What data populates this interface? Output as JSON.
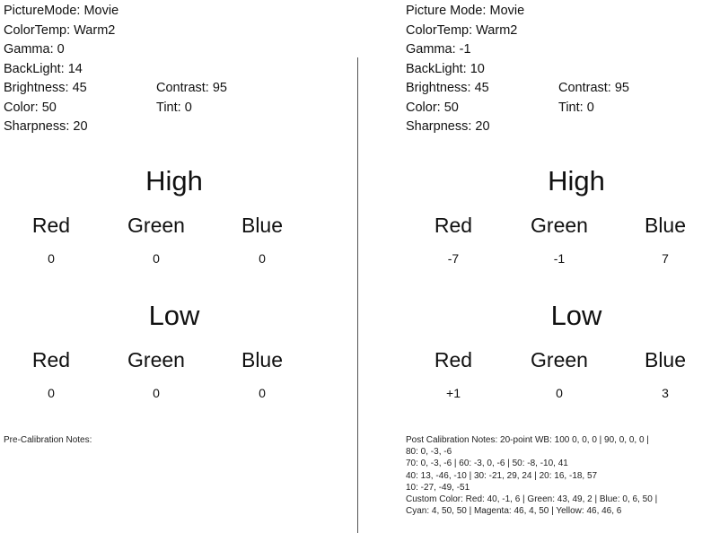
{
  "pre": {
    "settings": {
      "picture_mode": "PictureMode: Movie",
      "color_temp": "ColorTemp: Warm2",
      "gamma": "Gamma: 0",
      "backlight": "BackLight: 14",
      "brightness": "Brightness: 45",
      "contrast": "Contrast: 95",
      "color": "Color: 50",
      "tint": "Tint: 0",
      "sharpness": "Sharpness: 20"
    },
    "high": {
      "title": "High",
      "labels": [
        "Red",
        "Green",
        "Blue"
      ],
      "values": [
        "0",
        "0",
        "0"
      ]
    },
    "low": {
      "title": "Low",
      "labels": [
        "Red",
        "Green",
        "Blue"
      ],
      "values": [
        "0",
        "0",
        "0"
      ]
    },
    "notes": [
      "Pre-Calibration Notes:"
    ]
  },
  "post": {
    "settings": {
      "picture_mode": "Picture Mode: Movie",
      "color_temp": "ColorTemp: Warm2",
      "gamma": "Gamma: -1",
      "backlight": "BackLight: 10",
      "brightness": "Brightness: 45",
      "contrast": "Contrast: 95",
      "color": "Color: 50",
      "tint": "Tint: 0",
      "sharpness": "Sharpness: 20"
    },
    "high": {
      "title": "High",
      "labels": [
        "Red",
        "Green",
        "Blue"
      ],
      "values": [
        "-7",
        "-1",
        "7"
      ]
    },
    "low": {
      "title": "Low",
      "labels": [
        "Red",
        "Green",
        "Blue"
      ],
      "values": [
        "+1",
        "0",
        "3"
      ]
    },
    "notes": [
      "Post Calibration Notes: 20-point WB: 100 0, 0, 0 | 90, 0, 0, 0 |",
      "80: 0, -3, -6",
      "70: 0, -3, -6 | 60: -3, 0, -6 | 50: -8, -10, 41",
      "40: 13, -46, -10 | 30: -21, 29, 24 | 20: 16, -18, 57",
      "10: -27, -49, -51",
      "Custom Color: Red: 40, -1, 6 | Green: 43, 49, 2 | Blue: 0, 6, 50 |",
      "Cyan: 4, 50, 50 | Magenta: 46, 4, 50 | Yellow: 46, 46, 6"
    ]
  }
}
